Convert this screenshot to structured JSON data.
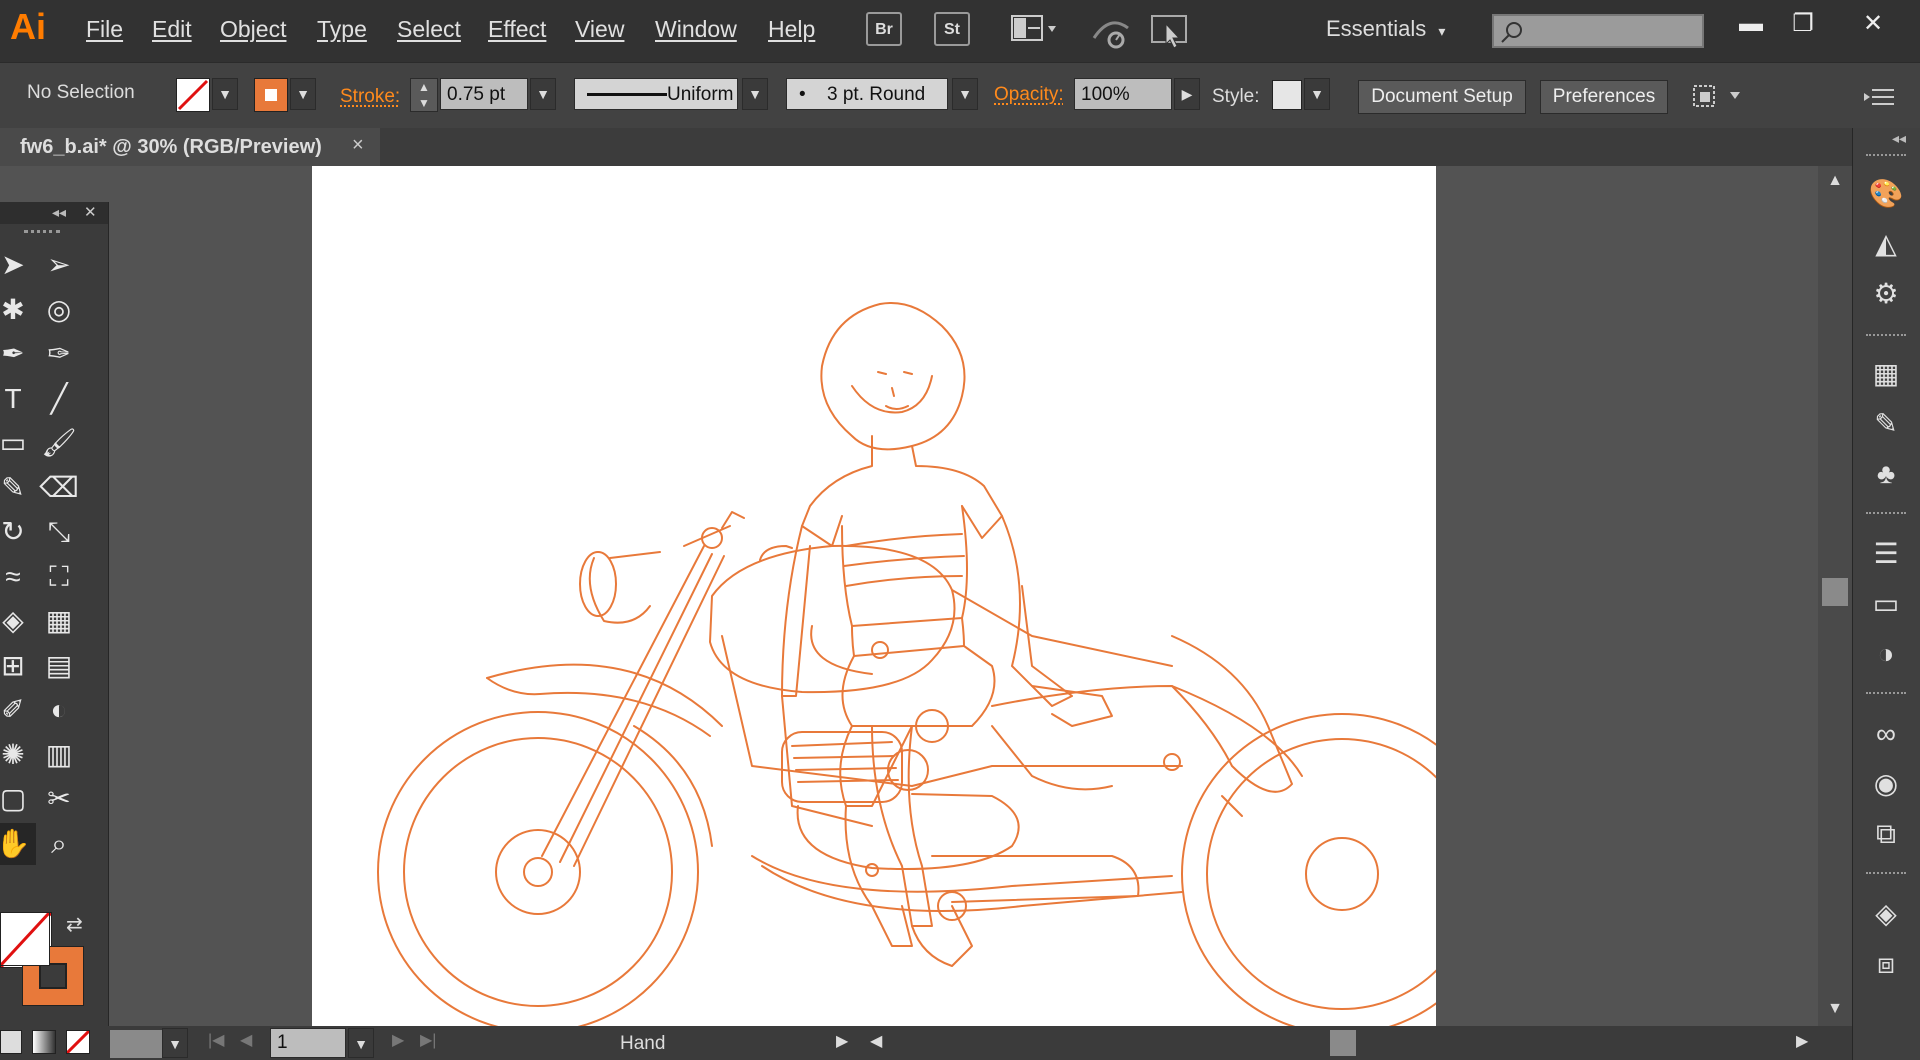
{
  "app": {
    "logo": "Ai",
    "accent": "#ff7c00"
  },
  "menu": {
    "items": [
      {
        "label": "File"
      },
      {
        "label": "Edit"
      },
      {
        "label": "Object"
      },
      {
        "label": "Type"
      },
      {
        "label": "Select"
      },
      {
        "label": "Effect"
      },
      {
        "label": "View"
      },
      {
        "label": "Window"
      },
      {
        "label": "Help"
      }
    ],
    "bridge_label": "Br",
    "stock_label": "St",
    "workspace": "Essentials"
  },
  "control": {
    "selection": "No Selection",
    "stroke_label": "Stroke:",
    "stroke_weight": "0.75 pt",
    "stroke_profile": "Uniform",
    "brush": "3 pt. Round",
    "opacity_label": "Opacity:",
    "opacity": "100%",
    "style_label": "Style:",
    "doc_setup": "Document Setup",
    "preferences": "Preferences"
  },
  "document": {
    "tab_label": "fw6_b.ai* @ 30% (RGB/Preview)",
    "art_color": "#e8793a"
  },
  "status": {
    "artboard_number": "1",
    "current_tool": "Hand"
  },
  "tools": [
    "selection-tool-icon",
    "direct-selection-tool-icon",
    "magic-wand-tool-icon",
    "lasso-tool-icon",
    "pen-tool-icon",
    "curvature-tool-icon",
    "type-tool-icon",
    "line-segment-tool-icon",
    "rectangle-tool-icon",
    "paintbrush-tool-icon",
    "pencil-tool-icon",
    "eraser-tool-icon",
    "rotate-tool-icon",
    "scale-tool-icon",
    "width-tool-icon",
    "free-transform-tool-icon",
    "shape-builder-tool-icon",
    "perspective-grid-tool-icon",
    "mesh-tool-icon",
    "gradient-tool-icon",
    "eyedropper-tool-icon",
    "blend-tool-icon",
    "symbol-sprayer-tool-icon",
    "column-graph-tool-icon",
    "artboard-tool-icon",
    "slice-tool-icon",
    "hand-tool-icon",
    "zoom-tool-icon"
  ],
  "dock_icons": [
    "color-panel-icon",
    "color-guide-icon",
    "cc-libraries-icon",
    "swatches-icon",
    "brushes-icon",
    "symbols-icon",
    "stroke-panel-icon",
    "gradient-panel-icon",
    "transparency-panel-icon",
    "creative-cloud-icon",
    "appearance-icon",
    "graphic-styles-icon",
    "layers-icon",
    "artboards-icon"
  ]
}
